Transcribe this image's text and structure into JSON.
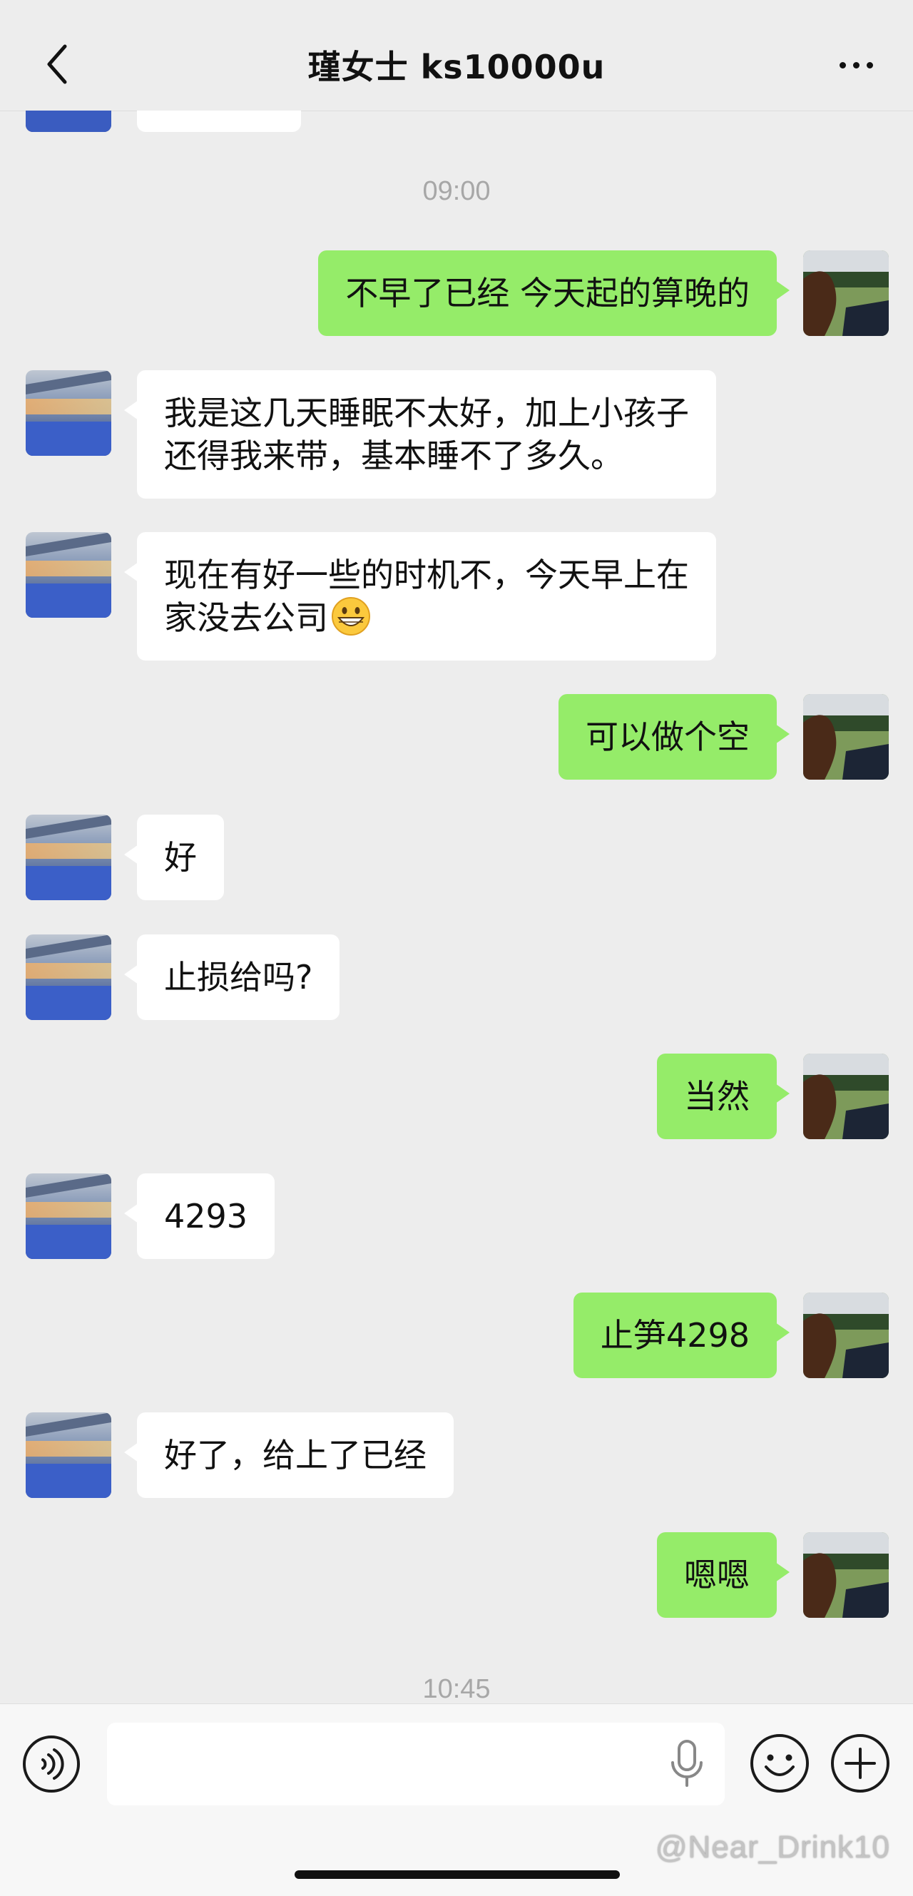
{
  "header": {
    "title": "瑾女士 ks10000u",
    "back_icon": "chevron-left-icon",
    "more_icon": "more-horizontal-icon"
  },
  "timestamps": [
    "09:00",
    "10:45"
  ],
  "messages": [
    {
      "side": "right",
      "text": "不早了已经 今天起的算晚的"
    },
    {
      "side": "left",
      "text": "我是这几天睡眠不太好，加上小孩子\n还得我来带，基本睡不了多久。"
    },
    {
      "side": "left",
      "text": "现在有好一些的时机不，今天早上在\n家没去公司",
      "emoji": "grinning-face"
    },
    {
      "side": "right",
      "text": "可以做个空"
    },
    {
      "side": "left",
      "text": "好"
    },
    {
      "side": "left",
      "text": "止损给吗?"
    },
    {
      "side": "right",
      "text": "当然"
    },
    {
      "side": "left",
      "text": "4293"
    },
    {
      "side": "right",
      "text": "止笋4298"
    },
    {
      "side": "left",
      "text": "好了，给上了已经"
    },
    {
      "side": "right",
      "text": "嗯嗯"
    }
  ],
  "input_bar": {
    "text_value": "",
    "icons": [
      "voice-icon",
      "microphone-icon",
      "emoji-icon",
      "plus-icon"
    ]
  },
  "watermark": "@Near_Drink10",
  "colors": {
    "background": "#ededed",
    "outgoing_bubble": "#95ec69",
    "incoming_bubble": "#ffffff",
    "timestamp": "#a7a7a7"
  }
}
